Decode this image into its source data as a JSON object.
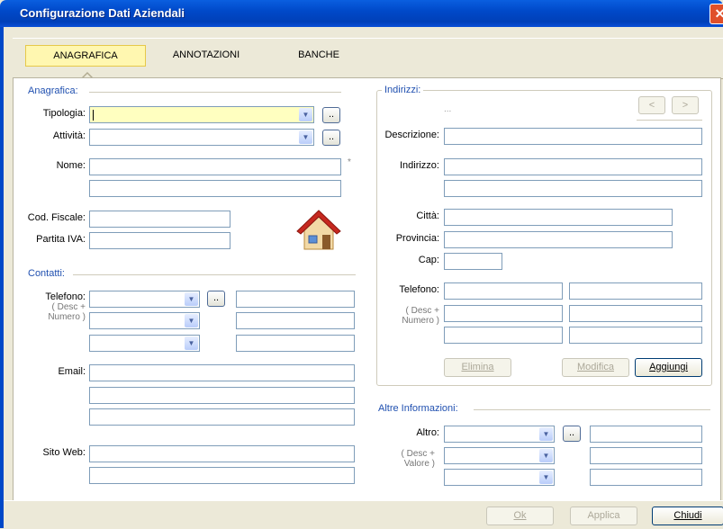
{
  "window": {
    "title": "Configurazione Dati Aziendali",
    "close_glyph": "✕"
  },
  "tabs": [
    {
      "label": "ANAGRAFICA",
      "active": true
    },
    {
      "label": "ANNOTAZIONI",
      "active": false
    },
    {
      "label": "BANCHE",
      "active": false
    }
  ],
  "anagrafica": {
    "section": "Anagrafica:",
    "tipologia_label": "Tipologia:",
    "attivita_label": "Attività:",
    "nome_label": "Nome:",
    "required_mark": "*",
    "cod_fiscale_label": "Cod. Fiscale:",
    "partita_iva_label": "Partita IVA:",
    "dot_label": "..",
    "house_icon": "house-icon"
  },
  "contatti": {
    "section": "Contatti:",
    "telefono_label": "Telefono:",
    "telefono_hint": "( Desc +\nNumero )",
    "email_label": "Email:",
    "sito_label": "Sito Web:",
    "dot_label": ".."
  },
  "indirizzi": {
    "section": "Indirizzi:",
    "counter": "...",
    "prev": "<",
    "next": ">",
    "descrizione_label": "Descrizione:",
    "indirizzo_label": "Indirizzo:",
    "citta_label": "Città:",
    "provincia_label": "Provincia:",
    "cap_label": "Cap:",
    "telefono_label": "Telefono:",
    "telefono_hint": "( Desc +\nNumero )",
    "elimina": "Elimina",
    "modifica": "Modifica",
    "aggiungi": "Aggiungi"
  },
  "altre": {
    "section": "Altre Informazioni:",
    "altro_label": "Altro:",
    "altro_hint": "( Desc +\nValore )",
    "dot_label": ".."
  },
  "footer": {
    "ok": "Ok",
    "applica": "Applica",
    "chiudi": "Chiudi"
  },
  "colors": {
    "title_bar": "#0049c9",
    "active_tab": "#fff7b0",
    "section_text": "#2050b0",
    "required_field": "#ffffc0"
  }
}
